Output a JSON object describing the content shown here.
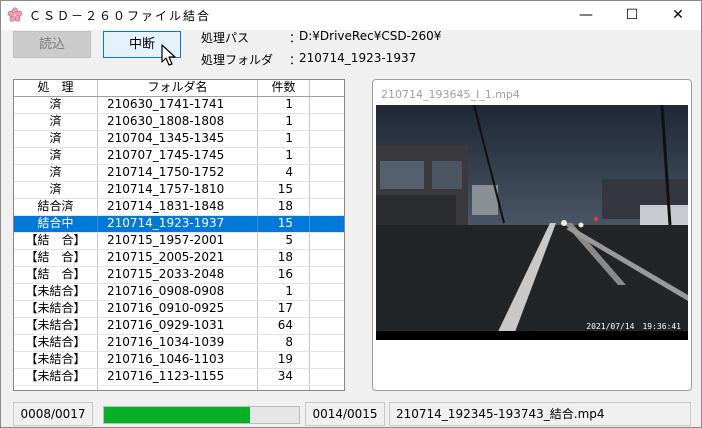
{
  "window": {
    "title": "ＣＳＤ－２６０ファイル結合",
    "minimize": "—",
    "maximize": "☐",
    "close": "✕"
  },
  "toolbar": {
    "load_label": "読込",
    "stop_label": "中断"
  },
  "info": {
    "path_label": "処理パス",
    "path_sep": "：",
    "path_value": "D:¥DriveRec¥CSD-260¥",
    "folder_label": "処理フォルダ",
    "folder_sep": "：",
    "folder_value": "210714_1923-1937"
  },
  "table": {
    "headers": [
      "処　理",
      "フォルダ名",
      "件数",
      ""
    ],
    "rows": [
      {
        "status": "済",
        "folder": "210630_1741-1741",
        "count": "1"
      },
      {
        "status": "済",
        "folder": "210630_1808-1808",
        "count": "1"
      },
      {
        "status": "済",
        "folder": "210704_1345-1345",
        "count": "1"
      },
      {
        "status": "済",
        "folder": "210707_1745-1745",
        "count": "1"
      },
      {
        "status": "済",
        "folder": "210714_1750-1752",
        "count": "4"
      },
      {
        "status": "済",
        "folder": "210714_1757-1810",
        "count": "15"
      },
      {
        "status": "結合済",
        "folder": "210714_1831-1848",
        "count": "18"
      },
      {
        "status": "結合中",
        "folder": "210714_1923-1937",
        "count": "15",
        "selected": true
      },
      {
        "status": "【結　合】",
        "folder": "210715_1957-2001",
        "count": "5"
      },
      {
        "status": "【結　合】",
        "folder": "210715_2005-2021",
        "count": "18"
      },
      {
        "status": "【結　合】",
        "folder": "210715_2033-2048",
        "count": "16"
      },
      {
        "status": "【未結合】",
        "folder": "210716_0908-0908",
        "count": "1"
      },
      {
        "status": "【未結合】",
        "folder": "210716_0910-0925",
        "count": "17"
      },
      {
        "status": "【未結合】",
        "folder": "210716_0929-1031",
        "count": "64"
      },
      {
        "status": "【未結合】",
        "folder": "210716_1034-1039",
        "count": "8"
      },
      {
        "status": "【未結合】",
        "folder": "210716_1046-1103",
        "count": "19"
      },
      {
        "status": "【未結合】",
        "folder": "210716_1123-1155",
        "count": "34"
      },
      {
        "status": "",
        "folder": "",
        "count": ""
      }
    ]
  },
  "preview": {
    "title": "210714_193645_I_1.mp4",
    "timestamp": "2021/07/14　19:36:41"
  },
  "statusbar": {
    "folder_progress": "0008/0017",
    "file_progress": "0014/0015",
    "progress_fraction": 0.75,
    "progress_color": "#06b025",
    "output_file": "210714_192345-193743_結合.mp4"
  },
  "icons": [
    "sakura-icon",
    "mouse-cursor-icon"
  ]
}
